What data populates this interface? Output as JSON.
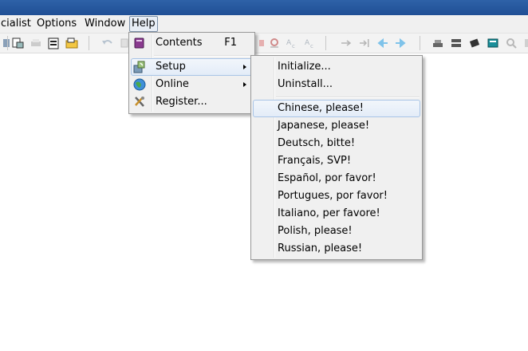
{
  "menubar": {
    "items": [
      {
        "label": "cialist"
      },
      {
        "label": "Options"
      },
      {
        "label": "Window"
      },
      {
        "label": "Help",
        "active": true
      }
    ]
  },
  "help_menu": {
    "items": [
      {
        "label": "Contents",
        "accelerator": "F1",
        "icon": "book-icon"
      },
      {
        "label": "Setup",
        "submenu": true,
        "icon": "setup-icon",
        "highlighted": true
      },
      {
        "label": "Online",
        "submenu": true,
        "icon": "globe-icon"
      },
      {
        "label": "Register...",
        "icon": "tools-icon"
      }
    ]
  },
  "setup_submenu": {
    "items": [
      {
        "label": "Initialize..."
      },
      {
        "label": "Uninstall..."
      },
      {
        "label": "Chinese, please!",
        "highlighted": true
      },
      {
        "label": "Japanese, please!"
      },
      {
        "label": "Deutsch, bitte!"
      },
      {
        "label": "Français, SVP!"
      },
      {
        "label": "Español, por favor!"
      },
      {
        "label": "Portugues, por favor!"
      },
      {
        "label": "Italiano, per favore!"
      },
      {
        "label": "Polish, please!"
      },
      {
        "label": "Russian, please!"
      }
    ]
  },
  "colors": {
    "titlebar": "#1f4f95",
    "menu_background": "#f0f0f0",
    "highlight_border": "#a8c4e6",
    "arrow_icon": "#7fc3ea"
  }
}
